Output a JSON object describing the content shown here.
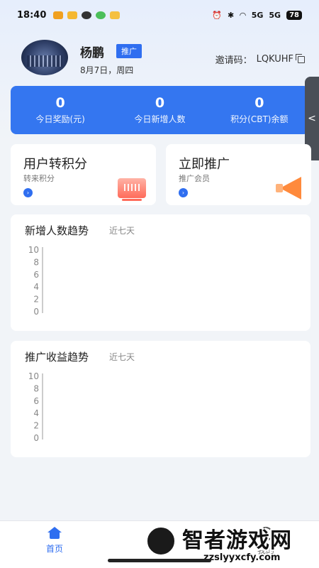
{
  "status_bar": {
    "time": "18:40",
    "signal1": "5G",
    "signal2": "5G",
    "battery": "78"
  },
  "profile": {
    "name": "杨鹏",
    "tag": "推广",
    "date": "8月7日，周四",
    "invite_label": "邀请码：",
    "invite_code": "LQKUHF"
  },
  "stats": [
    {
      "value": "0",
      "label": "今日奖励(元)"
    },
    {
      "value": "0",
      "label": "今日新增人数"
    },
    {
      "value": "0",
      "label": "积分(CBT)余额"
    }
  ],
  "side_handle": {
    "glyph": "<"
  },
  "cards": {
    "transfer": {
      "title": "用户转积分",
      "subtitle": "转来积分"
    },
    "promote": {
      "title": "立即推广",
      "subtitle": "推广会员"
    }
  },
  "charts_meta": {
    "new_users": {
      "title": "新增人数趋势",
      "range": "近七天"
    },
    "income": {
      "title": "推广收益趋势",
      "range": "近七天"
    }
  },
  "chart_data": [
    {
      "type": "line",
      "title": "新增人数趋势",
      "subtitle": "近七天",
      "yticks": [
        10,
        8,
        6,
        4,
        2,
        0
      ],
      "ylim": [
        0,
        10
      ],
      "series": []
    },
    {
      "type": "line",
      "title": "推广收益趋势",
      "subtitle": "近七天",
      "yticks": [
        10,
        8,
        6,
        4,
        2,
        0
      ],
      "ylim": [
        0,
        10
      ],
      "series": []
    }
  ],
  "bottom_nav": {
    "home": "首页",
    "middle": "",
    "me": "我的"
  },
  "watermark": {
    "text": "智者游戏网",
    "url": "zzslyyxcfy.com"
  },
  "colors": {
    "accent": "#2f6ef0",
    "stats_bg": "#3476f0"
  }
}
